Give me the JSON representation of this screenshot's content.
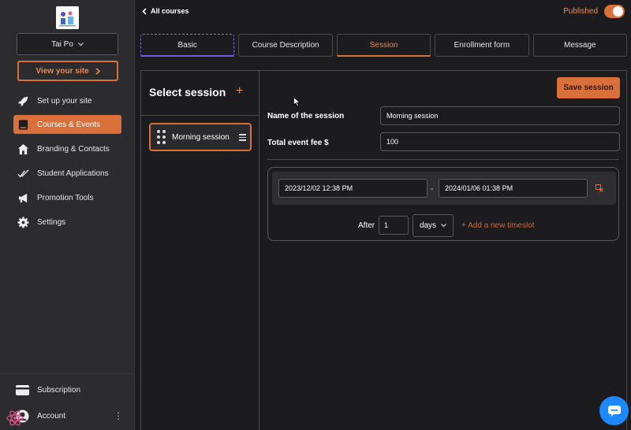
{
  "sidebar": {
    "location": "Tai Po",
    "view_site": "View your site",
    "items": [
      {
        "label": "Set up your site",
        "icon": "rocket-icon"
      },
      {
        "label": "Courses & Events",
        "icon": "book-icon",
        "active": true
      },
      {
        "label": "Branding & Contacts",
        "icon": "home-icon"
      },
      {
        "label": "Student Applications",
        "icon": "check-double-icon"
      },
      {
        "label": "Promotion Tools",
        "icon": "megaphone-icon"
      },
      {
        "label": "Settings",
        "icon": "gear-icon"
      }
    ],
    "bottom": {
      "subscription": "Subscription",
      "account": "Account"
    }
  },
  "topbar": {
    "back_label": "All courses",
    "published_label": "Published",
    "published_on": true
  },
  "tabs": [
    "Basic",
    "Course Description",
    "Session",
    "Enrollment form",
    "Message"
  ],
  "active_tab": "Session",
  "session_panel": {
    "title": "Select session",
    "sessions": [
      {
        "name": "Morning session"
      }
    ]
  },
  "form": {
    "save_label": "Save session",
    "name_label": "Name of the session",
    "name_value": "Morning session",
    "fee_label": "Total event fee $",
    "fee_value": "100",
    "timeslot": {
      "start": "2023/12/02 12:38 PM",
      "separator": "-",
      "end": "2024/01/06 01:38 PM"
    },
    "after_label": "After",
    "after_value": "1",
    "unit": "days",
    "add_timeslot": "+ Add a new timeslot"
  },
  "colors": {
    "accent": "#d9703a",
    "basic_tab_underline": "#6e5de0",
    "chat_button": "#1e88ff"
  }
}
